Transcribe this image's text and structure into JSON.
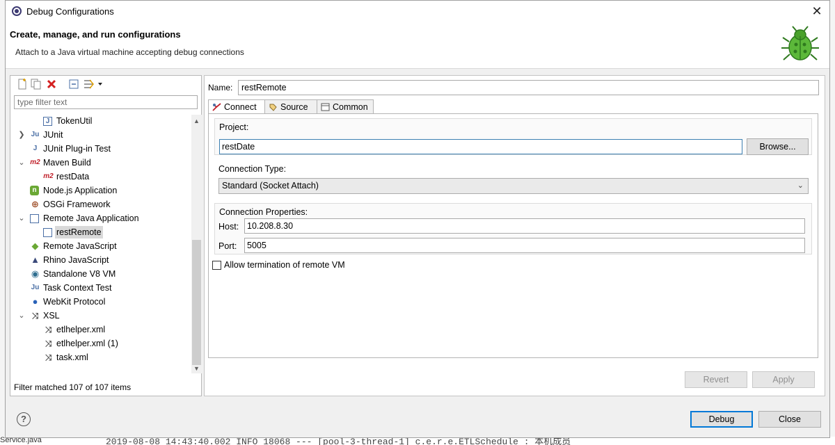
{
  "window": {
    "title": "Debug Configurations"
  },
  "header": {
    "title": "Create, manage, and run configurations",
    "message": "Attach to a Java virtual machine accepting debug connections"
  },
  "left_panel": {
    "filter_placeholder": "type filter text",
    "tree": [
      {
        "label": "TokenUtil",
        "icon": "junit-class-icon",
        "expander": ""
      },
      {
        "label": "JUnit",
        "icon": "junit-icon",
        "expander": ">"
      },
      {
        "label": "JUnit Plug-in Test",
        "icon": "junit-plugin-icon",
        "expander": ""
      },
      {
        "label": "Maven Build",
        "icon": "maven-icon",
        "expander": "v"
      },
      {
        "label": "restData",
        "icon": "maven-icon",
        "expander": ""
      },
      {
        "label": "Node.js Application",
        "icon": "nodejs-icon",
        "expander": ""
      },
      {
        "label": "OSGi Framework",
        "icon": "osgi-icon",
        "expander": ""
      },
      {
        "label": "Remote Java Application",
        "icon": "remote-java-icon",
        "expander": "v"
      },
      {
        "label": "restRemote",
        "icon": "remote-java-icon",
        "expander": "",
        "selected": true
      },
      {
        "label": "Remote JavaScript",
        "icon": "remote-js-icon",
        "expander": ""
      },
      {
        "label": "Rhino JavaScript",
        "icon": "rhino-icon",
        "expander": ""
      },
      {
        "label": "Standalone V8 VM",
        "icon": "v8-icon",
        "expander": ""
      },
      {
        "label": "Task Context Test",
        "icon": "task-context-icon",
        "expander": ""
      },
      {
        "label": "WebKit Protocol",
        "icon": "webkit-icon",
        "expander": ""
      },
      {
        "label": "XSL",
        "icon": "xsl-icon",
        "expander": "v"
      },
      {
        "label": "etlhelper.xml",
        "icon": "xsl-icon",
        "expander": ""
      },
      {
        "label": "etlhelper.xml (1)",
        "icon": "xsl-icon",
        "expander": ""
      },
      {
        "label": "task.xml",
        "icon": "xsl-icon",
        "expander": ""
      }
    ],
    "filter_status": "Filter matched 107 of 107 items"
  },
  "right_panel": {
    "name_label": "Name:",
    "name_value": "restRemote",
    "tabs": [
      {
        "label": "Connect",
        "icon": "connect-icon",
        "active": true
      },
      {
        "label": "Source",
        "icon": "source-icon",
        "active": false
      },
      {
        "label": "Common",
        "icon": "common-icon",
        "active": false
      }
    ],
    "project_group_title": "Project:",
    "project_value": "restDate",
    "browse_label": "Browse...",
    "connection_type_title": "Connection Type:",
    "connection_type_value": "Standard (Socket Attach)",
    "connection_props_title": "Connection Properties:",
    "host_label": "Host:",
    "host_value": "10.208.8.30",
    "port_label": "Port:",
    "port_value": "5005",
    "allow_termination_label": "Allow termination of remote VM",
    "allow_termination_checked": false,
    "revert_label": "Revert",
    "apply_label": "Apply"
  },
  "footer": {
    "debug_label": "Debug",
    "close_label": "Close",
    "help_glyph": "?"
  },
  "background": {
    "file_label": "Service.java",
    "log_line": "2019-08-08 14:43:40.002  INFO 18068 --- [pool-3-thread-1] c.e.r.e.ETLSchedule                  : 本机成员"
  },
  "colors": {
    "accent": "#0078d7",
    "dialog_bg": "#f0f0f0"
  }
}
